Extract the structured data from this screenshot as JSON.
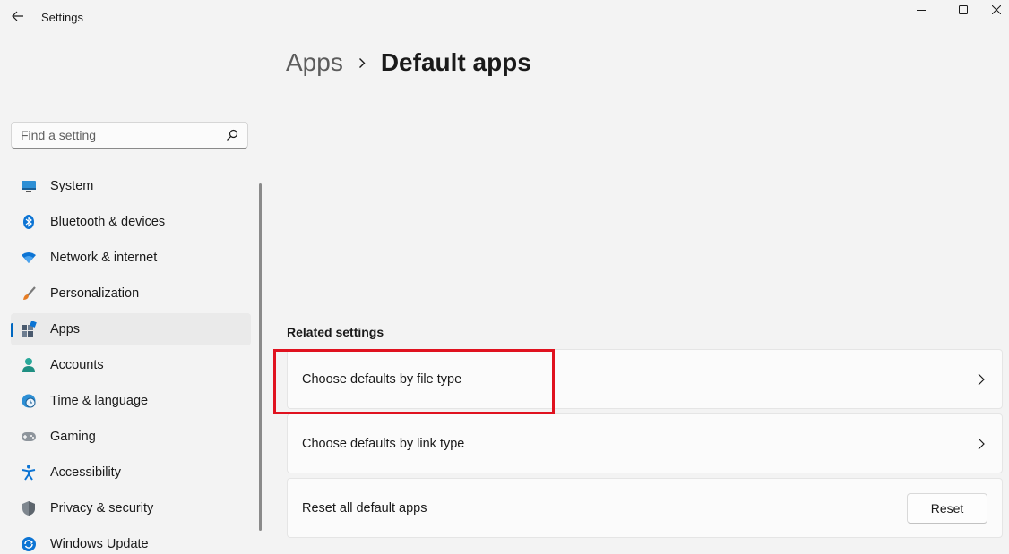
{
  "window": {
    "title": "Settings"
  },
  "breadcrumb": {
    "parent": "Apps",
    "current": "Default apps"
  },
  "search": {
    "placeholder": "Find a setting"
  },
  "sidebar": {
    "items": [
      {
        "label": "System",
        "icon": "monitor-icon",
        "active": false
      },
      {
        "label": "Bluetooth & devices",
        "icon": "bluetooth-icon",
        "active": false
      },
      {
        "label": "Network & internet",
        "icon": "wifi-icon",
        "active": false
      },
      {
        "label": "Personalization",
        "icon": "paintbrush-icon",
        "active": false
      },
      {
        "label": "Apps",
        "icon": "apps-icon",
        "active": true
      },
      {
        "label": "Accounts",
        "icon": "person-icon",
        "active": false
      },
      {
        "label": "Time & language",
        "icon": "globe-clock-icon",
        "active": false
      },
      {
        "label": "Gaming",
        "icon": "gamepad-icon",
        "active": false
      },
      {
        "label": "Accessibility",
        "icon": "accessibility-icon",
        "active": false
      },
      {
        "label": "Privacy & security",
        "icon": "shield-icon",
        "active": false
      },
      {
        "label": "Windows Update",
        "icon": "update-icon",
        "active": false
      }
    ]
  },
  "related": {
    "title": "Related settings",
    "file_type": "Choose defaults by file type",
    "link_type": "Choose defaults by link type",
    "reset_label": "Reset all default apps",
    "reset_button": "Reset"
  },
  "colors": {
    "accent": "#0067c0",
    "highlight": "#e0121f",
    "background": "#f3f3f3"
  }
}
